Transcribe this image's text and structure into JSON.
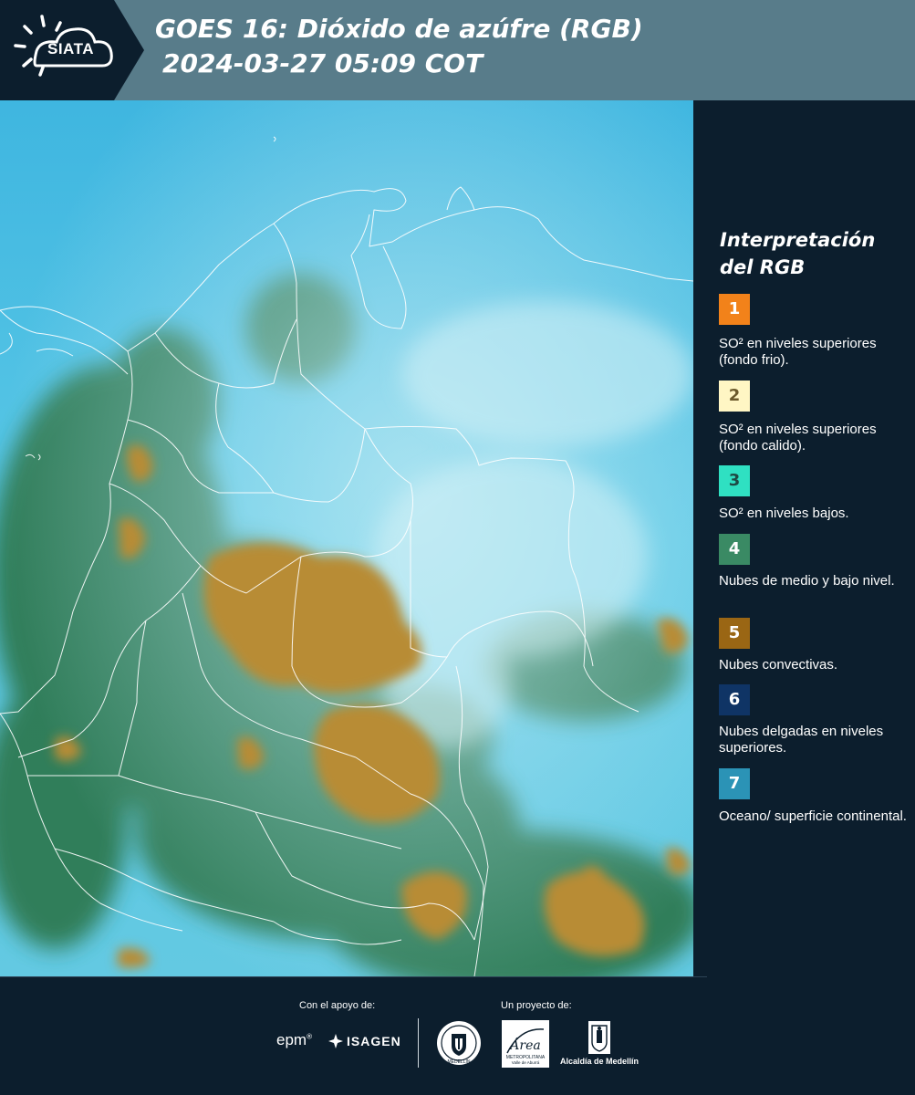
{
  "header": {
    "logo_text": "SIATA",
    "title_line1": "GOES 16: Dióxido de azúfre (RGB)",
    "title_line2": "2024-03-27 05:09 COT",
    "colors": {
      "bar": "#587c8a",
      "logo_bg": "#0c1e2d"
    }
  },
  "legend": {
    "title": "Interpretación del RGB",
    "items": [
      {
        "number": "1",
        "color": "#f2821a",
        "text_color": "#ffffff",
        "label": "SO² en niveles superiores (fondo frio)."
      },
      {
        "number": "2",
        "color": "#fff6c4",
        "text_color": "#6b5a2c",
        "label": "SO² en niveles superiores (fondo calido)."
      },
      {
        "number": "3",
        "color": "#2fe0c2",
        "text_color": "#1e4a44",
        "label": "SO² en niveles bajos."
      },
      {
        "number": "4",
        "color": "#3a8a64",
        "text_color": "#ffffff",
        "label": "Nubes de medio y bajo nivel."
      },
      {
        "number": "5",
        "color": "#9a6614",
        "text_color": "#ffffff",
        "label": "Nubes convectivas."
      },
      {
        "number": "6",
        "color": "#0f3465",
        "text_color": "#ffffff",
        "label": "Nubes delgadas en niveles superiores."
      },
      {
        "number": "7",
        "color": "#2b93b6",
        "text_color": "#ffffff",
        "label": "Oceano/ superficie continental."
      }
    ]
  },
  "footer": {
    "support_label": "Con el apoyo de:",
    "project_label": "Un proyecto de:",
    "sponsors": {
      "epm": "epm",
      "isagen": "ISAGEN"
    },
    "seal_text": "MEDELLÍN",
    "area_logo_text": "Área",
    "area_sub1": "METROPOLITANA",
    "area_sub2": "Valle de Aburrá",
    "alcaldia": "Alcaldía de Medellín"
  },
  "map": {
    "colors": {
      "background_sky": "#59c6e6",
      "convective": "#b58a32",
      "mid_low_cloud": "#2f7a52",
      "borders": "#ffffff"
    }
  }
}
